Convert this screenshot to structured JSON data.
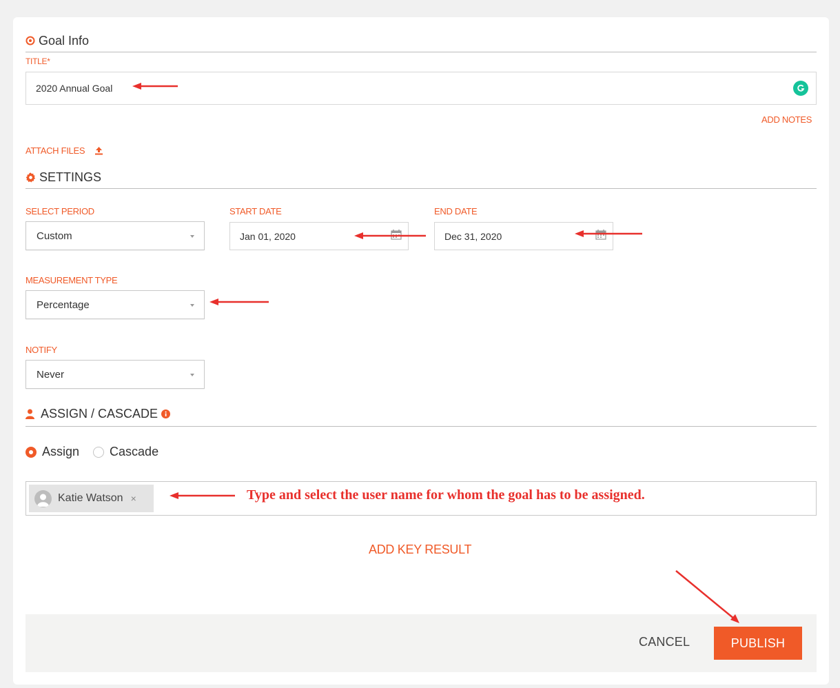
{
  "goal_info": {
    "heading": "Goal Info"
  },
  "title_field": {
    "label": "TITLE",
    "required_mark": "*",
    "value": "2020 Annual Goal"
  },
  "add_notes": "ADD NOTES",
  "attach_files": "ATTACH FILES",
  "settings": {
    "heading": "SETTINGS"
  },
  "period": {
    "label": "SELECT PERIOD",
    "value": "Custom"
  },
  "start_date": {
    "label": "START DATE",
    "value": "Jan 01, 2020"
  },
  "end_date": {
    "label": "END DATE",
    "value": "Dec 31, 2020"
  },
  "measurement": {
    "label": "MEASUREMENT TYPE",
    "value": "Percentage"
  },
  "notify": {
    "label": "NOTIFY",
    "value": "Never"
  },
  "assign_cascade": {
    "heading": "ASSIGN / CASCADE",
    "options": [
      "Assign",
      "Cascade"
    ],
    "selected": "Assign"
  },
  "assignee": {
    "name": "Katie Watson",
    "remove": "×"
  },
  "annotation": "Type and select the user name for whom the goal has to be assigned.",
  "add_key_result": "ADD KEY RESULT",
  "footer": {
    "cancel": "CANCEL",
    "publish": "PUBLISH"
  },
  "colors": {
    "accent": "#f05a28",
    "annotation_arrow": "#e8302c",
    "grammarly": "#15c39a"
  },
  "icons": [
    "target-icon",
    "upload-icon",
    "gear-icon",
    "user-icon",
    "info-icon",
    "calendar-icon",
    "grammarly-icon",
    "avatar-icon",
    "remove-icon",
    "caret-down-icon"
  ]
}
